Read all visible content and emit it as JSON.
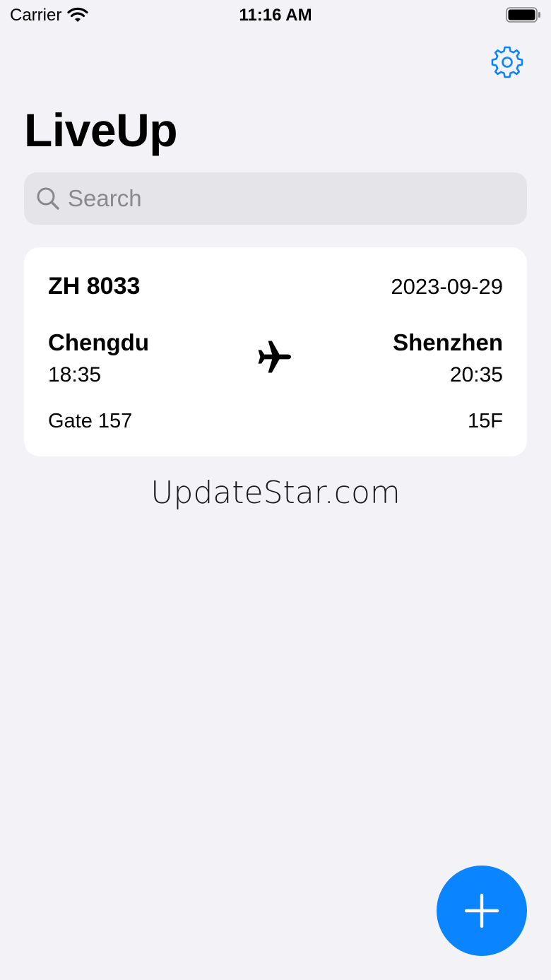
{
  "status_bar": {
    "carrier": "Carrier",
    "time": "11:16 AM"
  },
  "header": {
    "title": "LiveUp",
    "settings_icon": "gear-icon"
  },
  "search": {
    "placeholder": "Search",
    "value": ""
  },
  "flights": [
    {
      "flight_number": "ZH 8033",
      "date": "2023-09-29",
      "origin_city": "Chengdu",
      "departure_time": "18:35",
      "destination_city": "Shenzhen",
      "arrival_time": "20:35",
      "gate": "Gate 157",
      "seat": "15F"
    }
  ],
  "watermark": "UpdateStar.com",
  "colors": {
    "accent": "#0a84ff",
    "background": "#f2f2f7",
    "card": "#ffffff",
    "search_fill": "#e4e4e9"
  }
}
